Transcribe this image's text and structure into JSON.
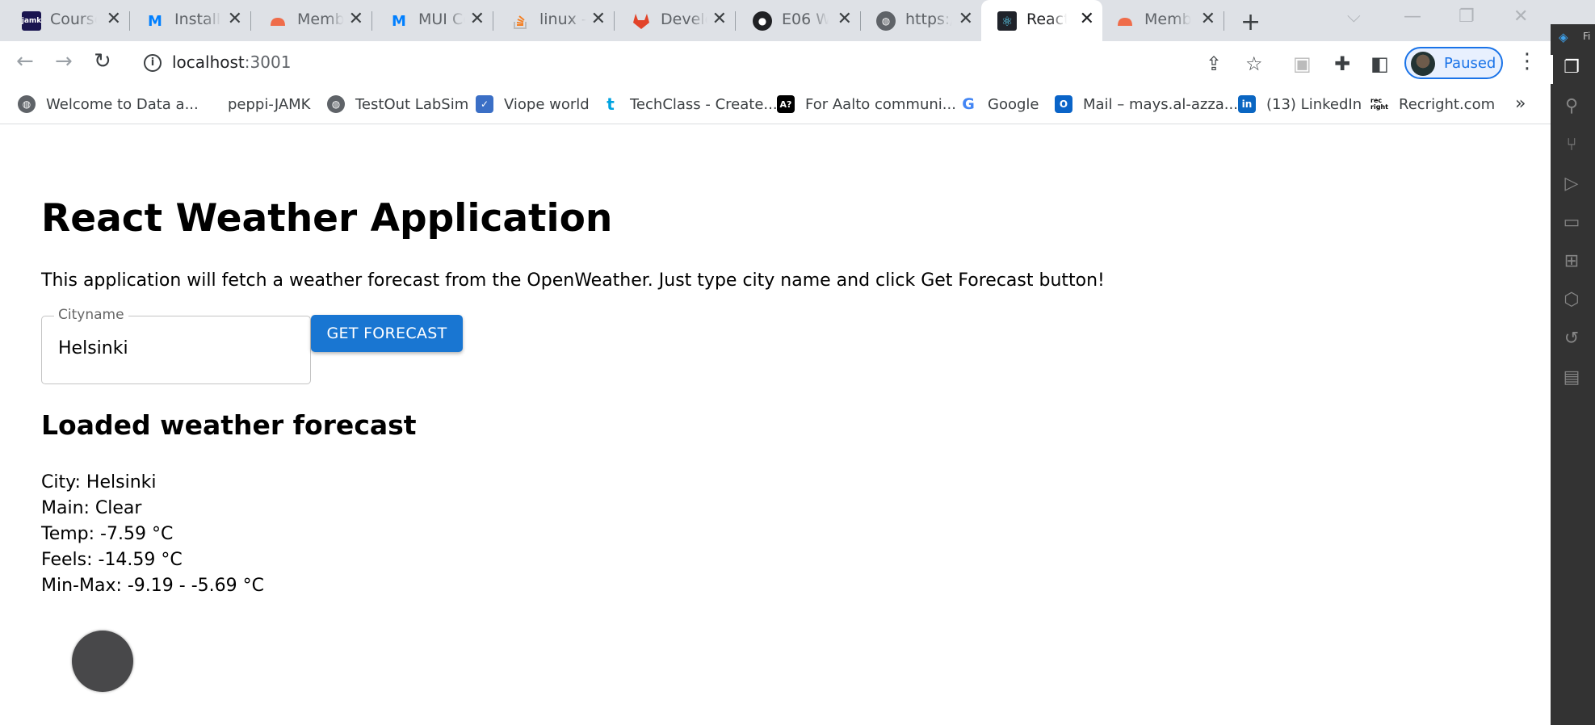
{
  "tabs": [
    {
      "title": "Course",
      "favicon": "jamk",
      "color": "#1a1550",
      "icon_name": "jamk-logo-icon"
    },
    {
      "title": "Installa",
      "favicon": "MUI",
      "color": "#007fff",
      "icon_name": "mui-logo-icon"
    },
    {
      "title": "Memb",
      "favicon": "",
      "color": "#ef6c4a",
      "icon_name": "membership-cloud-icon"
    },
    {
      "title": "MUI Co",
      "favicon": "MUI",
      "color": "#007fff",
      "icon_name": "mui-logo-icon"
    },
    {
      "title": "linux -",
      "favicon": "",
      "color": "#f48024",
      "icon_name": "stackoverflow-icon"
    },
    {
      "title": "Develo",
      "favicon": "",
      "color": "#e24329",
      "icon_name": "gitlab-icon"
    },
    {
      "title": "E06 W",
      "favicon": "",
      "color": "#202124",
      "icon_name": "github-icon"
    },
    {
      "title": "https:/",
      "favicon": "",
      "color": "#5f6368",
      "icon_name": "globe-icon"
    },
    {
      "title": "React /",
      "favicon": "",
      "color": "#20232a",
      "icon_name": "react-logo-icon",
      "active": true
    },
    {
      "title": "Memb",
      "favicon": "",
      "color": "#ef6c4a",
      "icon_name": "membership-cloud-icon"
    }
  ],
  "toolbar": {
    "url_host": "localhost",
    "url_port": ":3001",
    "profile_label": "Paused"
  },
  "bookmarks": [
    {
      "label": "Welcome to Data a...",
      "icon_name": "globe-icon",
      "color": "#5f6368"
    },
    {
      "label": "peppi-JAMK",
      "icon_name": "blank-icon",
      "color": "#ffffff"
    },
    {
      "label": "TestOut LabSim",
      "icon_name": "globe-icon",
      "color": "#5f6368"
    },
    {
      "label": "Viope world",
      "icon_name": "viope-icon",
      "color": "#3b6fc6"
    },
    {
      "label": "TechClass - Create...",
      "icon_name": "techclass-icon",
      "color": "#00a3e0"
    },
    {
      "label": "For Aalto communi...",
      "icon_name": "aalto-icon",
      "color": "#000000"
    },
    {
      "label": "Google",
      "icon_name": "google-icon",
      "color": "#4285f4"
    },
    {
      "label": "Mail – mays.al-azza...",
      "icon_name": "outlook-icon",
      "color": "#0a64c8"
    },
    {
      "label": "(13) LinkedIn",
      "icon_name": "linkedin-icon",
      "color": "#0a66c2"
    },
    {
      "label": "Recright.com",
      "icon_name": "recright-icon",
      "color": "#000000"
    }
  ],
  "app": {
    "title": "React Weather Application",
    "description": "This application will fetch a weather forecast from the OpenWeather. Just type city name and click Get Forecast button!",
    "city_label": "Cityname",
    "city_value": "Helsinki",
    "button_label": "GET FORECAST",
    "loaded_heading": "Loaded weather forecast",
    "lines": [
      "City: Helsinki",
      "Main: Clear",
      "Temp: -7.59 °C",
      "Feels: -14.59 °C",
      "Min-Max: -9.19 - -5.69 °C"
    ]
  },
  "colors": {
    "primary_button": "#1976d2",
    "chrome_tabstrip": "#dee1e6",
    "vscode_activitybar": "#333333"
  },
  "vscode": {
    "title_fragment": "Fi"
  }
}
